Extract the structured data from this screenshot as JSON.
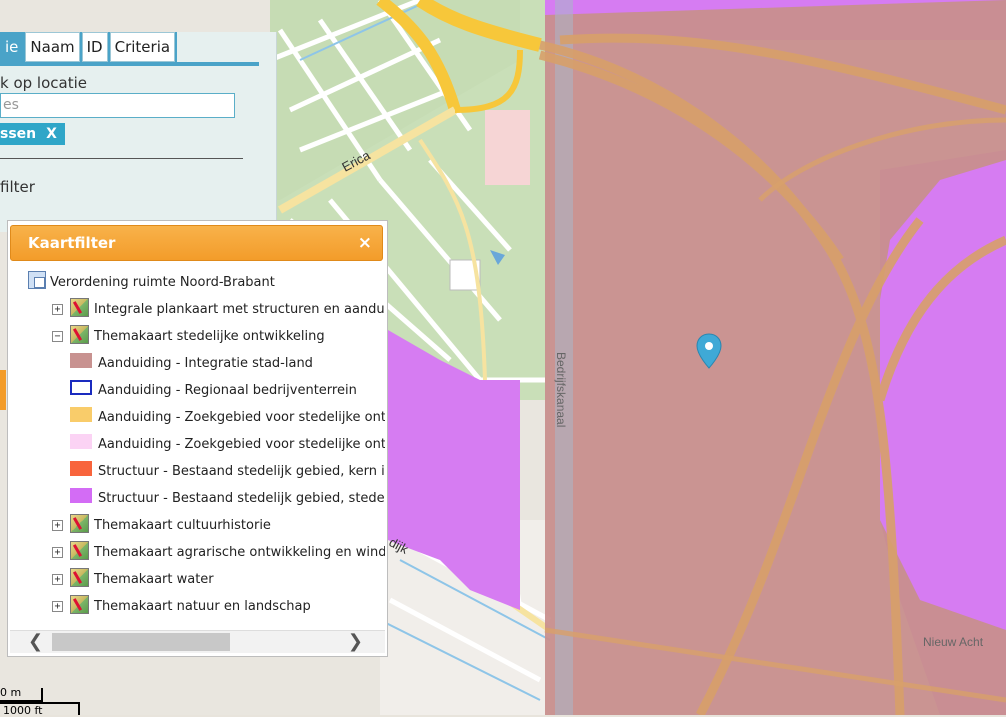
{
  "map": {
    "road_labels": [
      "Erica",
      "Bedrijfskanaal",
      "dijk"
    ],
    "place_labels": [
      "Nieuw Acht"
    ],
    "colors": {
      "integration_overlay": "#c88f8b",
      "urban_area": "#d67cf2",
      "motorway": "#f7c73a",
      "marker": "#3fa9d6"
    }
  },
  "search_panel": {
    "tabs": [
      "ie",
      "Naam",
      "ID",
      "Criteria"
    ],
    "active_tab_index": 0,
    "location_label": "k op locatie",
    "search_input_value": "es",
    "tag_label": "ssen",
    "tag_remove": "X",
    "filter_label": "filter"
  },
  "kaartfilter": {
    "title": "Kaartfilter",
    "close": "×",
    "root": "Verordening ruimte Noord-Brabant",
    "items": [
      {
        "type": "group",
        "expander": "+",
        "label": "Integrale plankaart met structuren en aanduidi"
      },
      {
        "type": "group",
        "expander": "−",
        "label": "Themakaart stedelijke ontwikkeling"
      },
      {
        "type": "legend",
        "swatch": "#c89290",
        "border": "#c89290",
        "label": "Aanduiding - Integratie stad-land"
      },
      {
        "type": "legend",
        "swatch": "#ffffff",
        "border": "#1a2bbf",
        "label": "Aanduiding - Regionaal bedrijventerrein"
      },
      {
        "type": "legend",
        "swatch": "#f9cc6a",
        "border": "#f9cc6a",
        "label": "Aanduiding - Zoekgebied voor stedelijke ontwi"
      },
      {
        "type": "legend",
        "swatch": "#fbd3f4",
        "border": "#fbd3f4",
        "label": "Aanduiding - Zoekgebied voor stedelijke ontwi"
      },
      {
        "type": "legend",
        "swatch": "#f8643c",
        "border": "#f8643c",
        "label": "Structuur - Bestaand stedelijk gebied, kern in"
      },
      {
        "type": "legend",
        "swatch": "#d36cf5",
        "border": "#d36cf5",
        "label": "Structuur - Bestaand stedelijk gebied, stedelij"
      },
      {
        "type": "group",
        "expander": "+",
        "label": "Themakaart cultuurhistorie"
      },
      {
        "type": "group",
        "expander": "+",
        "label": "Themakaart agrarische ontwikkeling en windtu"
      },
      {
        "type": "group",
        "expander": "+",
        "label": "Themakaart water"
      },
      {
        "type": "group",
        "expander": "+",
        "label": "Themakaart natuur en landschap"
      }
    ],
    "scroll_left": "❮",
    "scroll_right": "❯"
  },
  "scale": {
    "metric": "0 m",
    "imperial": "1000 ft"
  }
}
